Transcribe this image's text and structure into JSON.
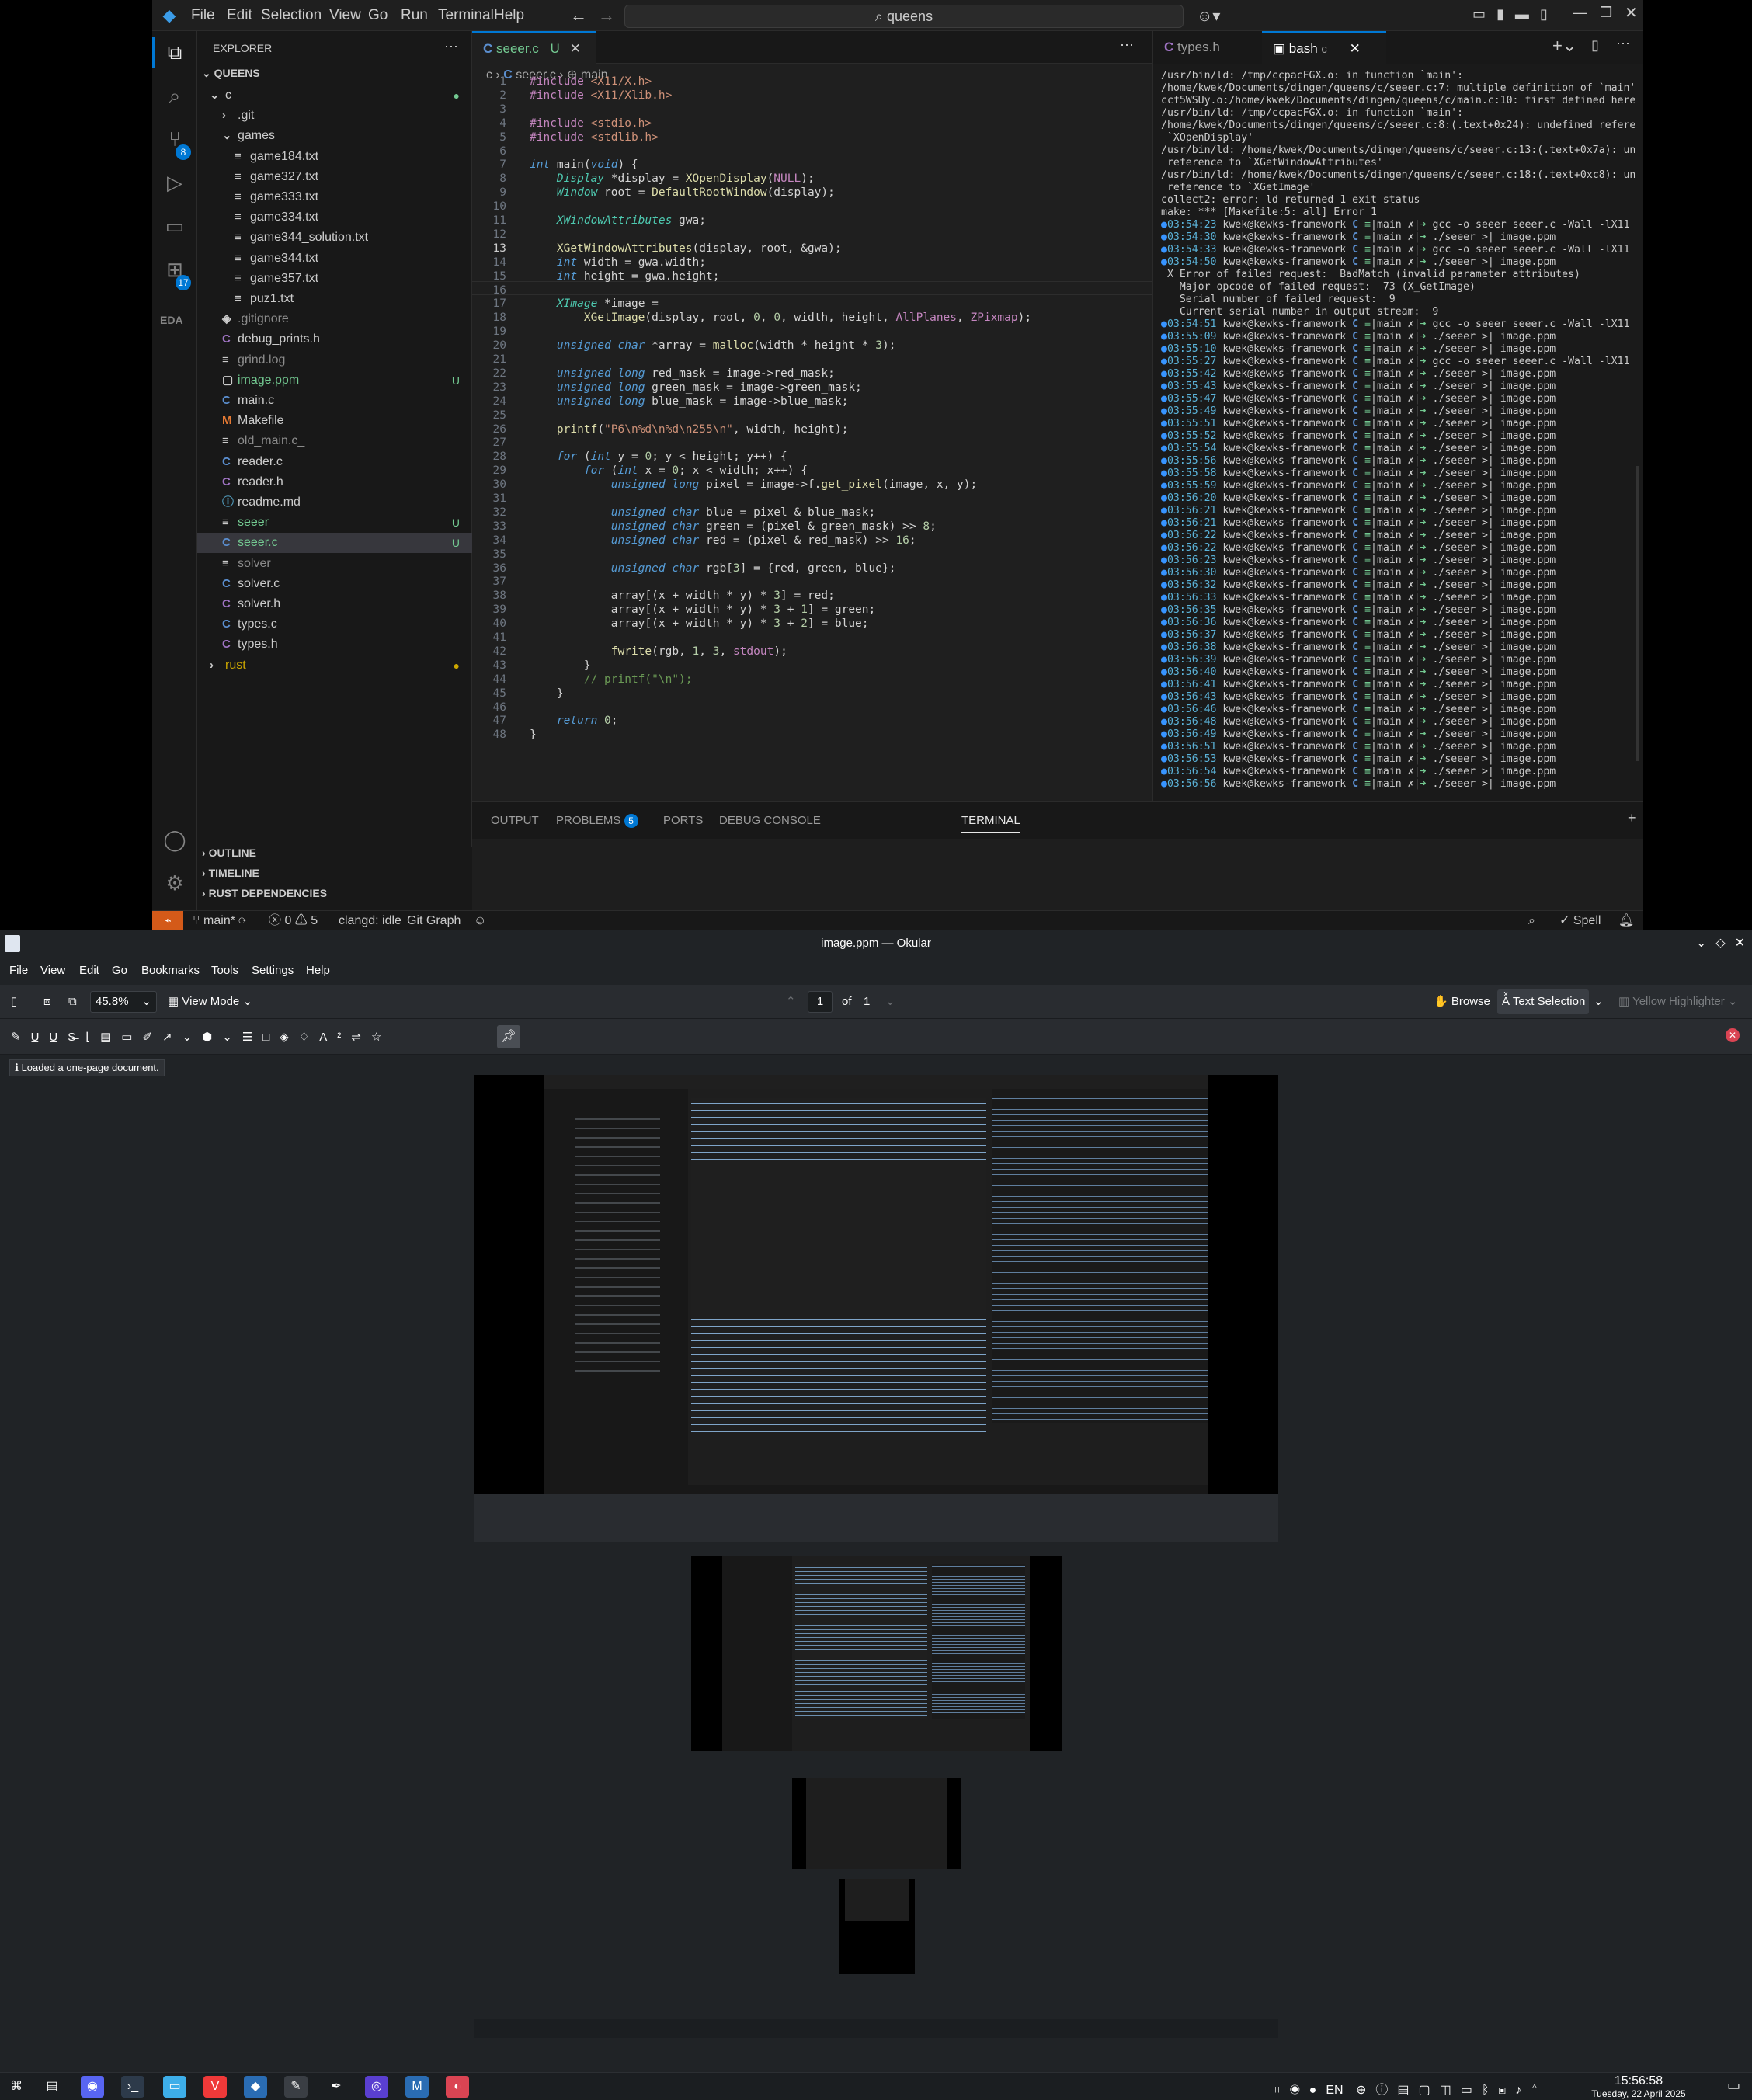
{
  "vscode": {
    "menu": [
      "File",
      "Edit",
      "Selection",
      "View",
      "Go",
      "Run",
      "Terminal",
      "Help"
    ],
    "search": "queens",
    "explorer_title": "EXPLORER",
    "root": "QUEENS",
    "scm_badge": "8",
    "ext_badge": "17",
    "eda_label": "EDA",
    "tree": [
      {
        "label": "c",
        "ic": "",
        "indent": 0,
        "status": "●"
      },
      {
        "label": ".git",
        "ic": "",
        "indent": 1,
        "status": ""
      },
      {
        "label": "games",
        "ic": "",
        "indent": 1,
        "status": ""
      },
      {
        "label": "game184.txt",
        "ic": "≡",
        "indent": 2,
        "status": ""
      },
      {
        "label": "game327.txt",
        "ic": "≡",
        "indent": 2,
        "status": ""
      },
      {
        "label": "game333.txt",
        "ic": "≡",
        "indent": 2,
        "status": ""
      },
      {
        "label": "game334.txt",
        "ic": "≡",
        "indent": 2,
        "status": ""
      },
      {
        "label": "game344_solution.txt",
        "ic": "≡",
        "indent": 2,
        "status": ""
      },
      {
        "label": "game344.txt",
        "ic": "≡",
        "indent": 2,
        "status": ""
      },
      {
        "label": "game357.txt",
        "ic": "≡",
        "indent": 2,
        "status": ""
      },
      {
        "label": "puz1.txt",
        "ic": "≡",
        "indent": 2,
        "status": ""
      },
      {
        "label": ".gitignore",
        "ic": "◈",
        "indent": 1,
        "status": ""
      },
      {
        "label": "debug_prints.h",
        "ic": "C",
        "indent": 1,
        "status": ""
      },
      {
        "label": "grind.log",
        "ic": "≡",
        "indent": 1,
        "status": ""
      },
      {
        "label": "image.ppm",
        "ic": "▢",
        "indent": 1,
        "status": "U"
      },
      {
        "label": "main.c",
        "ic": "C",
        "indent": 1,
        "status": ""
      },
      {
        "label": "Makefile",
        "ic": "M",
        "indent": 1,
        "status": ""
      },
      {
        "label": "old_main.c_",
        "ic": "≡",
        "indent": 1,
        "status": ""
      },
      {
        "label": "reader.c",
        "ic": "C",
        "indent": 1,
        "status": ""
      },
      {
        "label": "reader.h",
        "ic": "C",
        "indent": 1,
        "status": ""
      },
      {
        "label": "readme.md",
        "ic": "ⓘ",
        "indent": 1,
        "status": ""
      },
      {
        "label": "seeer",
        "ic": "≡",
        "indent": 1,
        "status": "U"
      },
      {
        "label": "seeer.c",
        "ic": "C",
        "indent": 1,
        "status": "U"
      },
      {
        "label": "solver",
        "ic": "≡",
        "indent": 1,
        "status": ""
      },
      {
        "label": "solver.c",
        "ic": "C",
        "indent": 1,
        "status": ""
      },
      {
        "label": "solver.h",
        "ic": "C",
        "indent": 1,
        "status": ""
      },
      {
        "label": "types.c",
        "ic": "C",
        "indent": 1,
        "status": ""
      },
      {
        "label": "types.h",
        "ic": "C",
        "indent": 1,
        "status": ""
      },
      {
        "label": "rust",
        "ic": "",
        "indent": 0,
        "status": "●"
      }
    ],
    "editor_tab": "seeer.c",
    "editor_tab_status": "U",
    "breadcrumb": [
      "c",
      "seeer.c",
      "main"
    ],
    "code_lines": [
      "#include <X11/X.h>",
      "#include <X11/Xlib.h>",
      "",
      "#include <stdio.h>",
      "#include <stdlib.h>",
      "",
      "int main(void) {",
      "    Display *display = XOpenDisplay(NULL);",
      "    Window root = DefaultRootWindow(display);",
      "",
      "    XWindowAttributes gwa;",
      "",
      "    XGetWindowAttributes(display, root, &gwa);",
      "    int width = gwa.width;",
      "    int height = gwa.height;",
      "",
      "    XImage *image =",
      "        XGetImage(display, root, 0, 0, width, height, AllPlanes, ZPixmap);",
      "",
      "    unsigned char *array = malloc(width * height * 3);",
      "",
      "    unsigned long red_mask = image->red_mask;",
      "    unsigned long green_mask = image->green_mask;",
      "    unsigned long blue_mask = image->blue_mask;",
      "",
      "    printf(\"P6\\n%d\\n%d\\n255\\n\", width, height);",
      "",
      "    for (int y = 0; y < height; y++) {",
      "        for (int x = 0; x < width; x++) {",
      "            unsigned long pixel = image->f.get_pixel(image, x, y);",
      "",
      "            unsigned char blue = pixel & blue_mask;",
      "            unsigned char green = (pixel & green_mask) >> 8;",
      "            unsigned char red = (pixel & red_mask) >> 16;",
      "",
      "            unsigned char rgb[3] = {red, green, blue};",
      "",
      "            array[(x + width * y) * 3] = red;",
      "            array[(x + width * y) * 3 + 1] = green;",
      "            array[(x + width * y) * 3 + 2] = blue;",
      "",
      "            fwrite(rgb, 1, 3, stdout);",
      "        }",
      "        // printf(\"\\n\");",
      "    }",
      "",
      "    return 0;",
      "}"
    ],
    "term_tabs": [
      "types.h",
      "bash",
      "c"
    ],
    "terminal_head": [
      "/usr/bin/ld: /tmp/ccpacFGX.o: in function `main':",
      "/home/kwek/Documents/dingen/queens/c/seeer.c:7: multiple definition of `main'; /tmp/",
      "ccf5WSUy.o:/home/kwek/Documents/dingen/queens/c/main.c:10: first defined here",
      "/usr/bin/ld: /tmp/ccpacFGX.o: in function `main':",
      "/home/kwek/Documents/dingen/queens/c/seeer.c:8:(.text+0x24): undefined reference to",
      " `XOpenDisplay'",
      "/usr/bin/ld: /home/kwek/Documents/dingen/queens/c/seeer.c:13:(.text+0x7a): undefined",
      " reference to `XGetWindowAttributes'",
      "/usr/bin/ld: /home/kwek/Documents/dingen/queens/c/seeer.c:18:(.text+0xc8): undefined",
      " reference to `XGetImage'",
      "collect2: error: ld returned 1 exit status",
      "make: *** [Makefile:5: all] Error 1"
    ],
    "terminal_prompts": [
      {
        "t": "03:54:23",
        "cmd": "gcc -o seeer seeer.c -Wall -lX11"
      },
      {
        "t": "03:54:30",
        "cmd": "./seeer >| image.ppm"
      },
      {
        "t": "03:54:33",
        "cmd": "gcc -o seeer seeer.c -Wall -lX11"
      },
      {
        "t": "03:54:50",
        "cmd": "./seeer >| image.ppm"
      }
    ],
    "terminal_error": [
      "X Error of failed request:  BadMatch (invalid parameter attributes)",
      "  Major opcode of failed request:  73 (X_GetImage)",
      "  Serial number of failed request:  9",
      "  Current serial number in output stream:  9"
    ],
    "terminal_prompts2": [
      {
        "t": "03:54:51",
        "cmd": "gcc -o seeer seeer.c -Wall -lX11"
      },
      {
        "t": "03:55:09",
        "cmd": "./seeer >| image.ppm"
      },
      {
        "t": "03:55:10",
        "cmd": "./seeer >| image.ppm"
      },
      {
        "t": "03:55:27",
        "cmd": "gcc -o seeer seeer.c -Wall -lX11"
      },
      {
        "t": "03:55:42",
        "cmd": "./seeer >| image.ppm"
      },
      {
        "t": "03:55:43",
        "cmd": "./seeer >| image.ppm"
      },
      {
        "t": "03:55:47",
        "cmd": "./seeer >| image.ppm"
      },
      {
        "t": "03:55:49",
        "cmd": "./seeer >| image.ppm"
      },
      {
        "t": "03:55:51",
        "cmd": "./seeer >| image.ppm"
      },
      {
        "t": "03:55:52",
        "cmd": "./seeer >| image.ppm"
      },
      {
        "t": "03:55:54",
        "cmd": "./seeer >| image.ppm"
      },
      {
        "t": "03:55:56",
        "cmd": "./seeer >| image.ppm"
      },
      {
        "t": "03:55:58",
        "cmd": "./seeer >| image.ppm"
      },
      {
        "t": "03:55:59",
        "cmd": "./seeer >| image.ppm"
      },
      {
        "t": "03:56:20",
        "cmd": "./seeer >| image.ppm"
      },
      {
        "t": "03:56:21",
        "cmd": "./seeer >| image.ppm"
      },
      {
        "t": "03:56:21",
        "cmd": "./seeer >| image.ppm"
      },
      {
        "t": "03:56:22",
        "cmd": "./seeer >| image.ppm"
      },
      {
        "t": "03:56:22",
        "cmd": "./seeer >| image.ppm"
      },
      {
        "t": "03:56:23",
        "cmd": "./seeer >| image.ppm"
      },
      {
        "t": "03:56:30",
        "cmd": "./seeer >| image.ppm"
      },
      {
        "t": "03:56:32",
        "cmd": "./seeer >| image.ppm"
      },
      {
        "t": "03:56:33",
        "cmd": "./seeer >| image.ppm"
      },
      {
        "t": "03:56:35",
        "cmd": "./seeer >| image.ppm"
      },
      {
        "t": "03:56:36",
        "cmd": "./seeer >| image.ppm"
      },
      {
        "t": "03:56:37",
        "cmd": "./seeer >| image.ppm"
      },
      {
        "t": "03:56:38",
        "cmd": "./seeer >| image.ppm"
      },
      {
        "t": "03:56:39",
        "cmd": "./seeer >| image.ppm"
      },
      {
        "t": "03:56:40",
        "cmd": "./seeer >| image.ppm"
      },
      {
        "t": "03:56:41",
        "cmd": "./seeer >| image.ppm"
      },
      {
        "t": "03:56:43",
        "cmd": "./seeer >| image.ppm"
      },
      {
        "t": "03:56:46",
        "cmd": "./seeer >| image.ppm"
      },
      {
        "t": "03:56:48",
        "cmd": "./seeer >| image.ppm"
      },
      {
        "t": "03:56:49",
        "cmd": "./seeer >| image.ppm"
      },
      {
        "t": "03:56:51",
        "cmd": "./seeer >| image.ppm"
      },
      {
        "t": "03:56:53",
        "cmd": "./seeer >| image.ppm"
      },
      {
        "t": "03:56:54",
        "cmd": "./seeer >| image.ppm"
      },
      {
        "t": "03:56:56",
        "cmd": "./seeer >| image.ppm"
      }
    ],
    "prompt_user": "kwek@kewks-framework",
    "prompt_branch": "main",
    "panel_tabs": [
      "OUTPUT",
      "PROBLEMS",
      "PORTS",
      "DEBUG CONSOLE",
      "TERMINAL"
    ],
    "problems_count": "5",
    "outline_sections": [
      "OUTLINE",
      "TIMELINE",
      "RUST DEPENDENCIES"
    ],
    "status": {
      "branch": "main*",
      "errors": "0",
      "warnings": "5",
      "clangd": "clangd: idle",
      "git_graph": "Git Graph",
      "spell": "Spell"
    }
  },
  "okular": {
    "title": "image.ppm — Okular",
    "menu": [
      "File",
      "View",
      "Edit",
      "Go",
      "Bookmarks",
      "Tools",
      "Settings",
      "Help"
    ],
    "zoom": "45.8%",
    "view_mode": "View Mode",
    "page": "1",
    "of": "of",
    "total": "1",
    "browse": "Browse",
    "text_selection": "Text Selection",
    "highlighter": "Yellow Highlighter",
    "message": "Loaded a one-page document."
  },
  "taskbar": {
    "time": "15:56:58",
    "date": "Tuesday, 22 April 2025",
    "lang": "EN"
  }
}
